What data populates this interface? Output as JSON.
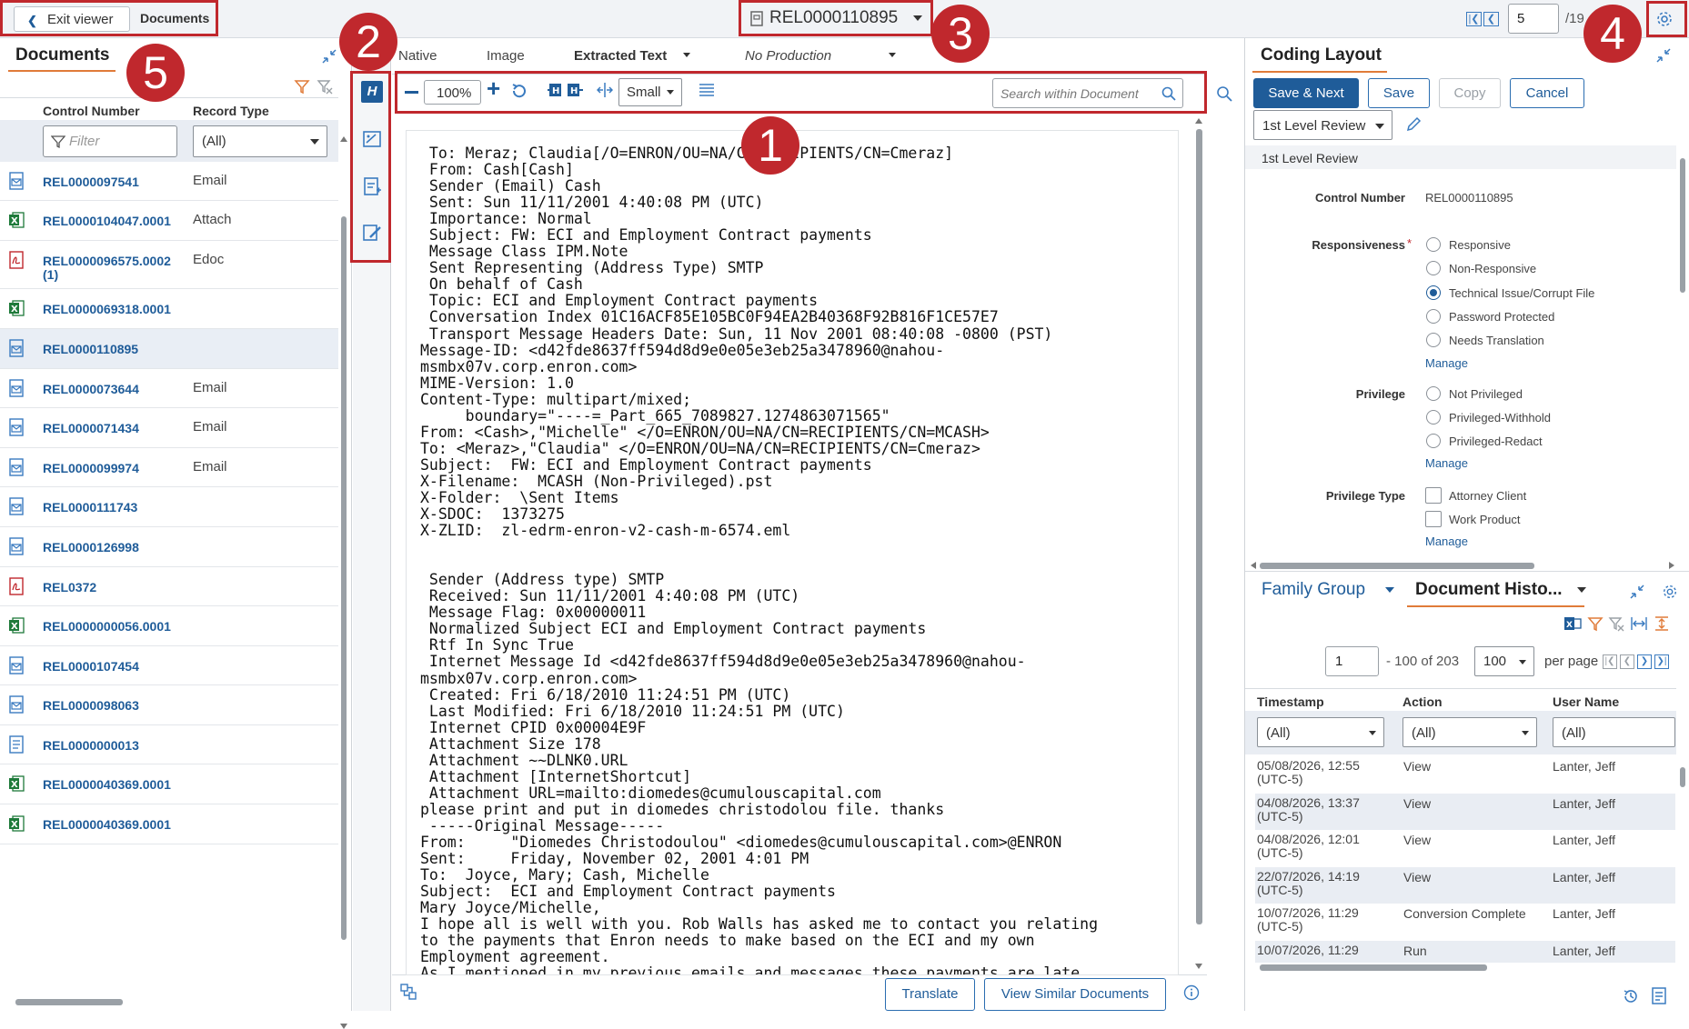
{
  "topbar": {
    "exit_label": "Exit viewer",
    "documents_label": "Documents",
    "doc_id": "REL0000110895",
    "page_current": "5",
    "page_total": "/19"
  },
  "left": {
    "title": "Documents",
    "col_control": "Control Number",
    "col_record": "Record Type",
    "filter_placeholder": "Filter",
    "record_filter": "(All)",
    "rows": [
      {
        "cn": "REL0000097541",
        "rt": "Email",
        "icon": "email-icon"
      },
      {
        "cn": "REL0000104047.0001",
        "rt": "Attach",
        "icon": "excel-icon"
      },
      {
        "cn": "REL0000096575.0002",
        "cn2": "(1)",
        "rt": "Edoc",
        "icon": "pdf-icon"
      },
      {
        "cn": "REL0000069318.0001",
        "rt": "",
        "icon": "excel-icon"
      },
      {
        "cn": "REL0000110895",
        "rt": "",
        "icon": "email-icon"
      },
      {
        "cn": "REL0000073644",
        "rt": "Email",
        "icon": "email-icon"
      },
      {
        "cn": "REL0000071434",
        "rt": "Email",
        "icon": "email-icon"
      },
      {
        "cn": "REL0000099974",
        "rt": "Email",
        "icon": "email-icon"
      },
      {
        "cn": "REL0000111743",
        "rt": "",
        "icon": "email-icon"
      },
      {
        "cn": "REL0000126998",
        "rt": "",
        "icon": "email-icon"
      },
      {
        "cn": "REL0372",
        "rt": "",
        "icon": "pdf-icon"
      },
      {
        "cn": "REL0000000056.0001",
        "rt": "",
        "icon": "excel-icon"
      },
      {
        "cn": "REL0000107454",
        "rt": "",
        "icon": "email-icon"
      },
      {
        "cn": "REL0000098063",
        "rt": "",
        "icon": "email-icon"
      },
      {
        "cn": "REL0000000013",
        "rt": "",
        "icon": "document-icon"
      },
      {
        "cn": "REL0000040369.0001",
        "rt": "",
        "icon": "excel-icon"
      },
      {
        "cn": "REL0000040369.0001",
        "rt": "",
        "icon": "excel-icon"
      }
    ]
  },
  "viewer": {
    "tabs": [
      "Native",
      "Image",
      "Extracted Text",
      "No Production"
    ],
    "zoom": "100%",
    "size": "Small",
    "search_placeholder": "Search within Document",
    "text_lines": [
      " To: Meraz; Claudia[/O=ENRON/OU=NA/CN=RECIPIENTS/CN=Cmeraz]",
      " From: Cash[Cash]",
      " Sender (Email) Cash",
      " Sent: Sun 11/11/2001 4:40:08 PM (UTC)",
      " Importance: Normal",
      " Subject: FW: ECI and Employment Contract payments",
      " Message Class IPM.Note",
      " Sent Representing (Address Type) SMTP",
      " On behalf of Cash",
      " Topic: ECI and Employment Contract payments",
      " Conversation Index 01C16ACF85E105BC0F94EA2B40368F92B816F1CE57E7",
      " Transport Message Headers Date: Sun, 11 Nov 2001 08:40:08 -0800 (PST)",
      "Message-ID: <d42fde8637ff594d8d9e0e05e3eb25a3478960@nahou-",
      "msmbx07v.corp.enron.com>",
      "MIME-Version: 1.0",
      "Content-Type: multipart/mixed;",
      "     boundary=\"----=_Part_665_7089827.1274863071565\"",
      "From: <Cash>,\"Michelle\" </O=ENRON/OU=NA/CN=RECIPIENTS/CN=MCASH>",
      "To: <Meraz>,\"Claudia\" </O=ENRON/OU=NA/CN=RECIPIENTS/CN=Cmeraz>",
      "Subject:  FW: ECI and Employment Contract payments",
      "X-Filename:  MCASH (Non-Privileged).pst",
      "X-Folder:  \\Sent Items",
      "X-SDOC:  1373275",
      "X-ZLID:  zl-edrm-enron-v2-cash-m-6574.eml",
      "",
      "",
      " Sender (Address type) SMTP",
      " Received: Sun 11/11/2001 4:40:08 PM (UTC)",
      " Message Flag: 0x00000011",
      " Normalized Subject ECI and Employment Contract payments",
      " Rtf In Sync True",
      " Internet Message Id <d42fde8637ff594d8d9e0e05e3eb25a3478960@nahou-",
      "msmbx07v.corp.enron.com>",
      " Created: Fri 6/18/2010 11:24:51 PM (UTC)",
      " Last Modified: Fri 6/18/2010 11:24:51 PM (UTC)",
      " Internet CPID 0x00004E9F",
      " Attachment Size 178",
      " Attachment ~~DLNK0.URL",
      " Attachment [InternetShortcut]",
      " Attachment URL=mailto:diomedes@cumulouscapital.com",
      "please print and put in diomedes christodolou file. thanks",
      " -----Original Message-----",
      "From:     \"Diomedes Christodoulou\" <diomedes@cumulouscapital.com>@ENRON",
      "Sent:     Friday, November 02, 2001 4:01 PM",
      "To:  Joyce, Mary; Cash, Michelle",
      "Subject:  ECI and Employment Contract payments",
      "Mary Joyce/Michelle,",
      "I hope all is well with you. Rob Walls has asked me to contact you relating",
      "to the payments that Enron needs to make based on the ECI and my own",
      "Employment agreement.",
      "As I mentioned in my previous emails and messages these payments are late"
    ],
    "translate_label": "Translate",
    "similar_label": "View Similar Documents"
  },
  "coding": {
    "title": "Coding Layout",
    "save_next": "Save & Next",
    "save": "Save",
    "copy": "Copy",
    "cancel": "Cancel",
    "layout_select": "1st Level Review",
    "layout_name": "1st Level Review",
    "control_label": "Control Number",
    "control_value": "REL0000110895",
    "resp_label": "Responsiveness",
    "resp_required": "*",
    "resp_options": [
      "Responsive",
      "Non-Responsive",
      "Technical Issue/Corrupt File",
      "Password Protected",
      "Needs Translation"
    ],
    "resp_selected": 2,
    "priv_label": "Privilege",
    "priv_options": [
      "Not Privileged",
      "Privileged-Withhold",
      "Privileged-Redact"
    ],
    "privtype_label": "Privilege Type",
    "privtype_options": [
      "Attorney Client",
      "Work Product"
    ],
    "manage": "Manage"
  },
  "history": {
    "tab_family": "Family Group",
    "tab_history": "Document Histo...",
    "page_input": "1",
    "range_text": "- 100 of 203",
    "per_page_value": "100",
    "per_page_label": "per page",
    "col_timestamp": "Timestamp",
    "col_action": "Action",
    "col_user": "User Name",
    "filter_all": "(All)",
    "rows": [
      {
        "ts1": "05/08/2026, 12:55",
        "ts2": "(UTC-5)",
        "action": "View",
        "user": "Lanter, Jeff"
      },
      {
        "ts1": "04/08/2026, 13:37",
        "ts2": "(UTC-5)",
        "action": "View",
        "user": "Lanter, Jeff"
      },
      {
        "ts1": "04/08/2026, 12:01",
        "ts2": "(UTC-5)",
        "action": "View",
        "user": "Lanter, Jeff"
      },
      {
        "ts1": "22/07/2026, 14:19",
        "ts2": "(UTC-5)",
        "action": "View",
        "user": "Lanter, Jeff"
      },
      {
        "ts1": "10/07/2026, 11:29",
        "ts2": "(UTC-5)",
        "action": "Conversion Complete",
        "user": "Lanter, Jeff"
      },
      {
        "ts1": "10/07/2026, 11:29",
        "ts2": "",
        "action": "Run",
        "user": "Lanter, Jeff"
      }
    ]
  },
  "callouts": [
    "1",
    "2",
    "3",
    "4",
    "5"
  ],
  "colors": {
    "accent": "#1f5c99",
    "callout": "#c0282d",
    "active_tab": "#e07b39"
  }
}
